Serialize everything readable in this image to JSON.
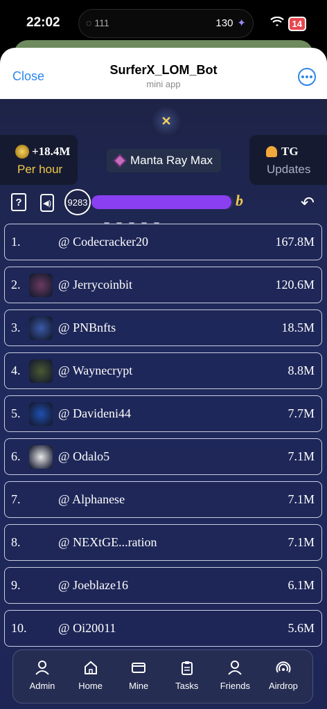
{
  "status_bar": {
    "time": "22:02",
    "island_left": "111",
    "island_right": "130",
    "battery": "14"
  },
  "header": {
    "close_label": "Close",
    "title": "SurferX_LOM_Bot",
    "subtitle": "mini app"
  },
  "stats": {
    "per_hour_value": "+18.4M",
    "per_hour_label": "Per hour",
    "league_name": "Manta Ray Max",
    "tg_label": "TG",
    "tg_sub": "Updates"
  },
  "progress": {
    "level": "9283",
    "fraction": 0.98
  },
  "leaderboard": [
    {
      "rank": "1.",
      "username": "@ Codecracker20",
      "score": "167.8M",
      "avatar_color": ""
    },
    {
      "rank": "2.",
      "username": "@ Jerrycoinbit",
      "score": "120.6M",
      "avatar_color": "#6b3b5e"
    },
    {
      "rank": "3.",
      "username": "@ PNBnfts",
      "score": "18.5M",
      "avatar_color": "#3a5aa8"
    },
    {
      "rank": "4.",
      "username": "@ Waynecrypt",
      "score": "8.8M",
      "avatar_color": "#4a5a30"
    },
    {
      "rank": "5.",
      "username": "@ Davideni44",
      "score": "7.7M",
      "avatar_color": "#1f4fb0"
    },
    {
      "rank": "6.",
      "username": "@ Odalo5",
      "score": "7.1M",
      "avatar_color": "#e8e8e8"
    },
    {
      "rank": "7.",
      "username": "@ Alphanese",
      "score": "7.1M",
      "avatar_color": ""
    },
    {
      "rank": "8.",
      "username": "@ NEXtGE...ration",
      "score": "7.1M",
      "avatar_color": ""
    },
    {
      "rank": "9.",
      "username": "@ Joeblaze16",
      "score": "6.1M",
      "avatar_color": ""
    },
    {
      "rank": "10.",
      "username": "@ Oi20011",
      "score": "5.6M",
      "avatar_color": ""
    }
  ],
  "nav": [
    {
      "label": "Admin",
      "icon": "user-icon"
    },
    {
      "label": "Home",
      "icon": "home-icon"
    },
    {
      "label": "Mine",
      "icon": "card-icon"
    },
    {
      "label": "Tasks",
      "icon": "clipboard-icon"
    },
    {
      "label": "Friends",
      "icon": "friends-icon"
    },
    {
      "label": "Airdrop",
      "icon": "airdrop-icon"
    }
  ]
}
